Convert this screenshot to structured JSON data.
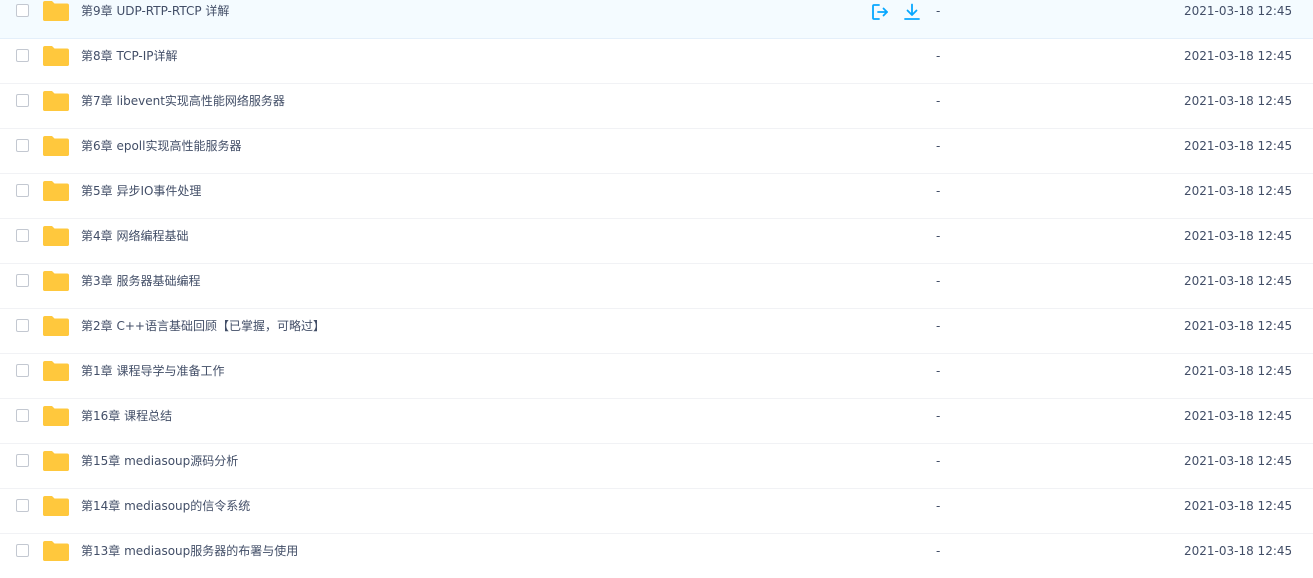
{
  "folder_color": "#ffc83d",
  "action_color": "#06a7ff",
  "rows": [
    {
      "name": "第9章 UDP-RTP-RTCP 详解",
      "size": "-",
      "modified": "2021-03-18 12:45",
      "hovered": true
    },
    {
      "name": "第8章 TCP-IP详解",
      "size": "-",
      "modified": "2021-03-18 12:45"
    },
    {
      "name": "第7章 libevent实现高性能网络服务器",
      "size": "-",
      "modified": "2021-03-18 12:45"
    },
    {
      "name": "第6章 epoll实现高性能服务器",
      "size": "-",
      "modified": "2021-03-18 12:45"
    },
    {
      "name": "第5章 异步IO事件处理",
      "size": "-",
      "modified": "2021-03-18 12:45"
    },
    {
      "name": "第4章 网络编程基础",
      "size": "-",
      "modified": "2021-03-18 12:45"
    },
    {
      "name": "第3章 服务器基础编程",
      "size": "-",
      "modified": "2021-03-18 12:45"
    },
    {
      "name": "第2章 C++语言基础回顾【已掌握，可略过】",
      "size": "-",
      "modified": "2021-03-18 12:45"
    },
    {
      "name": "第1章 课程导学与准备工作",
      "size": "-",
      "modified": "2021-03-18 12:45"
    },
    {
      "name": "第16章 课程总结",
      "size": "-",
      "modified": "2021-03-18 12:45"
    },
    {
      "name": "第15章 mediasoup源码分析",
      "size": "-",
      "modified": "2021-03-18 12:45"
    },
    {
      "name": "第14章 mediasoup的信令系统",
      "size": "-",
      "modified": "2021-03-18 12:45"
    },
    {
      "name": "第13章 mediasoup服务器的布署与使用",
      "size": "-",
      "modified": "2021-03-18 12:45"
    }
  ],
  "row_actions": {
    "share_icon": "share-icon",
    "download_icon": "download-icon"
  }
}
